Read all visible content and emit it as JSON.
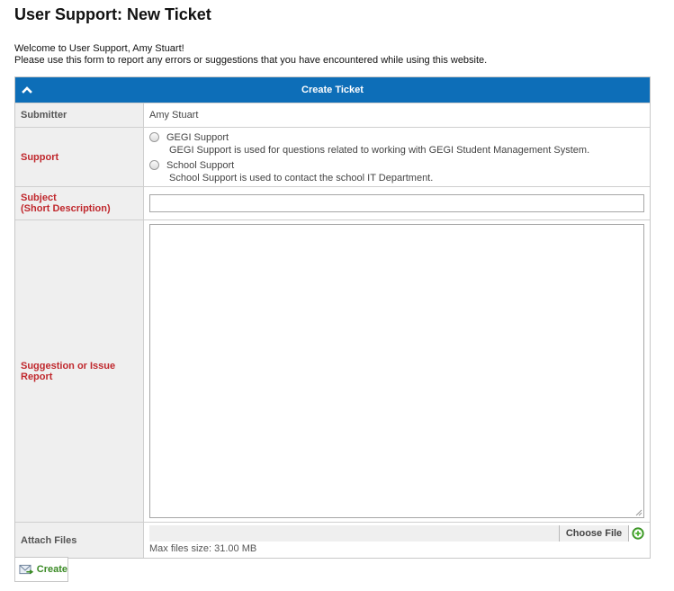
{
  "page": {
    "title": "User Support: New Ticket",
    "welcome": "Welcome to User Support, Amy Stuart!",
    "instructions": "Please use this form to report any errors or suggestions that you have encountered while using this website."
  },
  "form": {
    "header": "Create Ticket",
    "submitter_label": "Submitter",
    "submitter_value": "Amy Stuart",
    "support_label": "Support",
    "support_options": [
      {
        "label": "GEGI Support",
        "description": "GEGI Support is used for questions related to working with GEGI Student Management System."
      },
      {
        "label": "School Support",
        "description": "School Support is used to contact the school IT Department."
      }
    ],
    "subject_label_line1": "Subject",
    "subject_label_line2": "(Short Description)",
    "subject_value": "",
    "suggestion_label": "Suggestion or Issue Report",
    "suggestion_value": "",
    "attach_label": "Attach Files",
    "choose_file_label": "Choose File",
    "max_size_text": "Max files size: 31.00 MB"
  },
  "actions": {
    "create_label": "Create"
  },
  "colors": {
    "header_bg": "#0d6eb8",
    "required_label": "#c0282d",
    "create_text": "#3a8a24"
  }
}
